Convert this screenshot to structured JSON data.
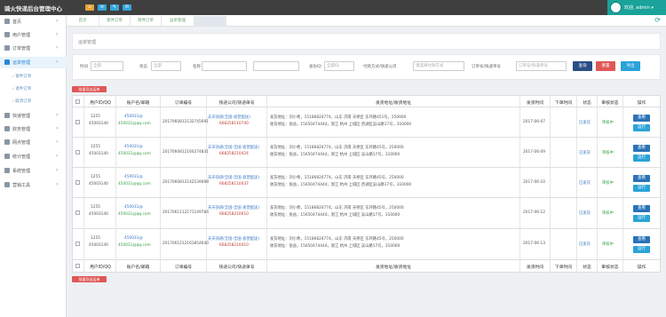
{
  "header": {
    "brand": "骑火快递后台管理中心",
    "user": "欢迎, admin ▾",
    "buttons": [
      "⌂",
      "≡",
      "✎",
      "✉"
    ]
  },
  "sidebar": {
    "items": [
      {
        "label": "首页",
        "arrow": "›"
      },
      {
        "label": "用户管理",
        "arrow": "›"
      },
      {
        "label": "订单管理",
        "arrow": "›"
      },
      {
        "label": "运单管理",
        "arrow": "›"
      },
      {
        "label": "快递管理",
        "arrow": "›"
      },
      {
        "label": "财务管理",
        "arrow": "›"
      },
      {
        "label": "网点管理",
        "arrow": "›"
      },
      {
        "label": "统计管理",
        "arrow": "›"
      },
      {
        "label": "系统管理",
        "arrow": "›"
      },
      {
        "label": "营销工具",
        "arrow": "›"
      }
    ],
    "subitems": [
      "› 寄件订单",
      "› 退件订单",
      "› 取消订单"
    ]
  },
  "tabs": [
    "首页",
    "寄件订单",
    "寄件订单",
    "运单管理"
  ],
  "breadcrumb": "运单管理",
  "filters": {
    "labels": [
      "时间",
      "状态",
      "名称",
      "省份ID",
      "付款方式/快递公司",
      "订单号/快递单号"
    ],
    "placeholders": [
      "全部",
      "全部",
      "",
      "",
      "全部ID",
      "请选择付款方式",
      "订单号/快递单号"
    ],
    "buttons": {
      "search": "查询",
      "reset": "重置",
      "export": "导出"
    }
  },
  "bulk_label": "批量导出运单",
  "table": {
    "headers": [
      "用户ID/QQ",
      "账户名/邮箱",
      "订单编号",
      "快递公司/快递单号",
      "发货地址/收货地址",
      "发货时间",
      "下单时间",
      "状态",
      "审核状态",
      "操作"
    ],
    "rows": [
      {
        "uid": "1255",
        "qq": "45003140",
        "acct": "450031@",
        "email": "450031@qq.com",
        "order": "2017060812132745691",
        "company": "天天快递(全国-直营配送)",
        "tracking": "668258110740",
        "addr1": "发货地址：刘小希，15186824774，山东 济南 天桥区 东环路451号，250000",
        "addr2": "收货地址：张益，15650474444，浙江 杭州 上城区 西湖区吴山路17号，310000",
        "ship": "2017-06-07",
        "order_time": "",
        "status": "已发货",
        "audit": "审核中",
        "actions": [
          "查看",
          "运行"
        ]
      },
      {
        "uid": "1255",
        "qq": "45003140",
        "acct": "450031@",
        "email": "450031@qq.com",
        "order": "2017060812160274831",
        "company": "天天快递(全国-全国-直营配送)",
        "tracking": "668258210424",
        "addr1": "发货地址：刘小希，15186824774，山东 济南 天桥区 东环路45号，250000",
        "addr2": "收货地址：张益，15650474444，浙江 杭州 上城区 吴山路17号，310000",
        "ship": "2017-06-09",
        "order_time": "",
        "status": "已发货",
        "audit": "审核中",
        "actions": [
          "查看",
          "运行"
        ]
      },
      {
        "uid": "1255",
        "qq": "45003140",
        "acct": "450031@",
        "email": "450031@qq.com",
        "order": "2017060812142539098",
        "company": "天天快递(全国-全国-直营配送)",
        "tracking": "668258110437",
        "addr1": "发货地址：刘小希，15186824774，山东 济南 天桥区 东环路45号，250000",
        "addr2": "收货地址：张益，15650474444，浙江 杭州 上城区 西湖区吴山路17号，310000",
        "ship": "2017-06-10",
        "order_time": "",
        "status": "已发货",
        "audit": "审核中",
        "actions": [
          "查看",
          "运行"
        ]
      },
      {
        "uid": "1255",
        "qq": "45003140",
        "acct": "450031@",
        "email": "450031@qq.com",
        "order": "2017061112171149784",
        "company": "天天快递(全国-全国-直营配送)",
        "tracking": "668258210610",
        "addr1": "发货地址：刘小希，15186824774，山东 济南 天桥区 东环路45号，250000",
        "addr2": "收货地址：张益，15650474444，浙江 杭州 上城区 吴山路17号，310000",
        "ship": "2017-06-12",
        "order_time": "",
        "status": "已发货",
        "audit": "审核中",
        "actions": [
          "查看",
          "运行"
        ]
      },
      {
        "uid": "1255",
        "qq": "45003140",
        "acct": "450031@",
        "email": "450031@qq.com",
        "order": "2017061212161854640",
        "company": "天天快递(全国-全国-直营配送)",
        "tracking": "668258210410",
        "addr1": "发货地址：刘小希，15186824774，山东 济南 天桥区 东环路45号，250000",
        "addr2": "收货地址：张益，15650474444，浙江 杭州 上城区 吴山路17号，310000",
        "ship": "2017-06-13",
        "order_time": "",
        "status": "已发货",
        "audit": "审核中",
        "actions": [
          "查看",
          "运行"
        ]
      }
    ]
  },
  "colors": {
    "topbar": "#3f3f3f",
    "accent": "#1aa39a",
    "primary": "#2a73b8",
    "danger": "#e05757"
  }
}
